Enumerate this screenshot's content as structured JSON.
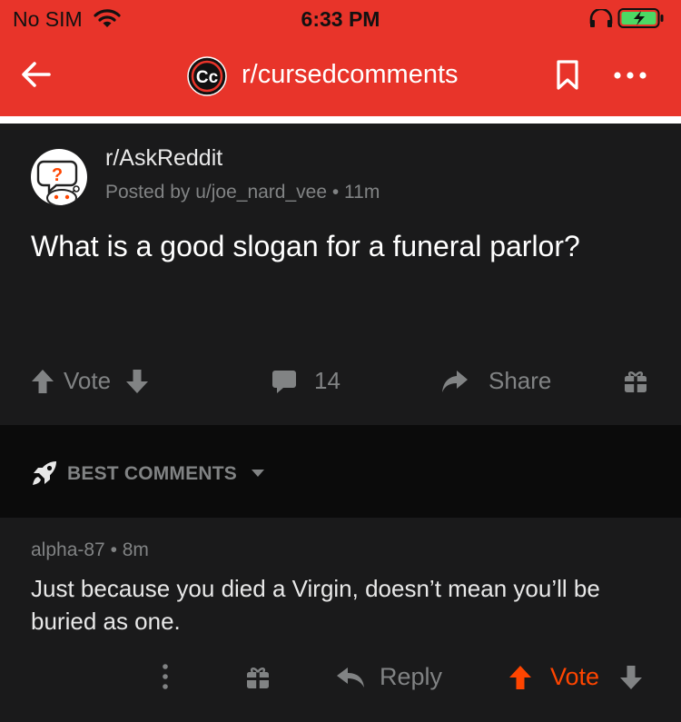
{
  "status_bar": {
    "carrier": "No SIM",
    "time": "6:33 PM"
  },
  "nav": {
    "title": "r/cursedcomments",
    "logo_text": "Cc"
  },
  "post": {
    "subreddit": "r/AskReddit",
    "meta": "Posted by u/joe_nard_vee • 11m",
    "title": "What is a good slogan for a funeral parlor?",
    "vote_label": "Vote",
    "comment_count": "14",
    "share_label": "Share"
  },
  "sort": {
    "label": "BEST COMMENTS"
  },
  "comment": {
    "meta": "alpha-87 • 8m",
    "body": "Just because you died a Virgin, doesn’t mean you’ll be buried as one.",
    "reply_label": "Reply",
    "vote_label": "Vote"
  },
  "colors": {
    "header": "#e8342a",
    "background": "#1a1a1b",
    "sortbar": "#0b0b0b",
    "upvote_accent": "#ff4500",
    "muted_text": "#818384"
  },
  "icons": [
    "wifi-icon",
    "headphones-icon",
    "battery-charging-icon",
    "back-arrow-icon",
    "bookmark-icon",
    "more-icon",
    "askreddit-avatar-icon",
    "upvote-icon",
    "downvote-icon",
    "comment-icon",
    "share-icon",
    "award-icon",
    "rocket-icon",
    "caret-down-icon",
    "reply-icon",
    "dots-vertical-icon"
  ]
}
